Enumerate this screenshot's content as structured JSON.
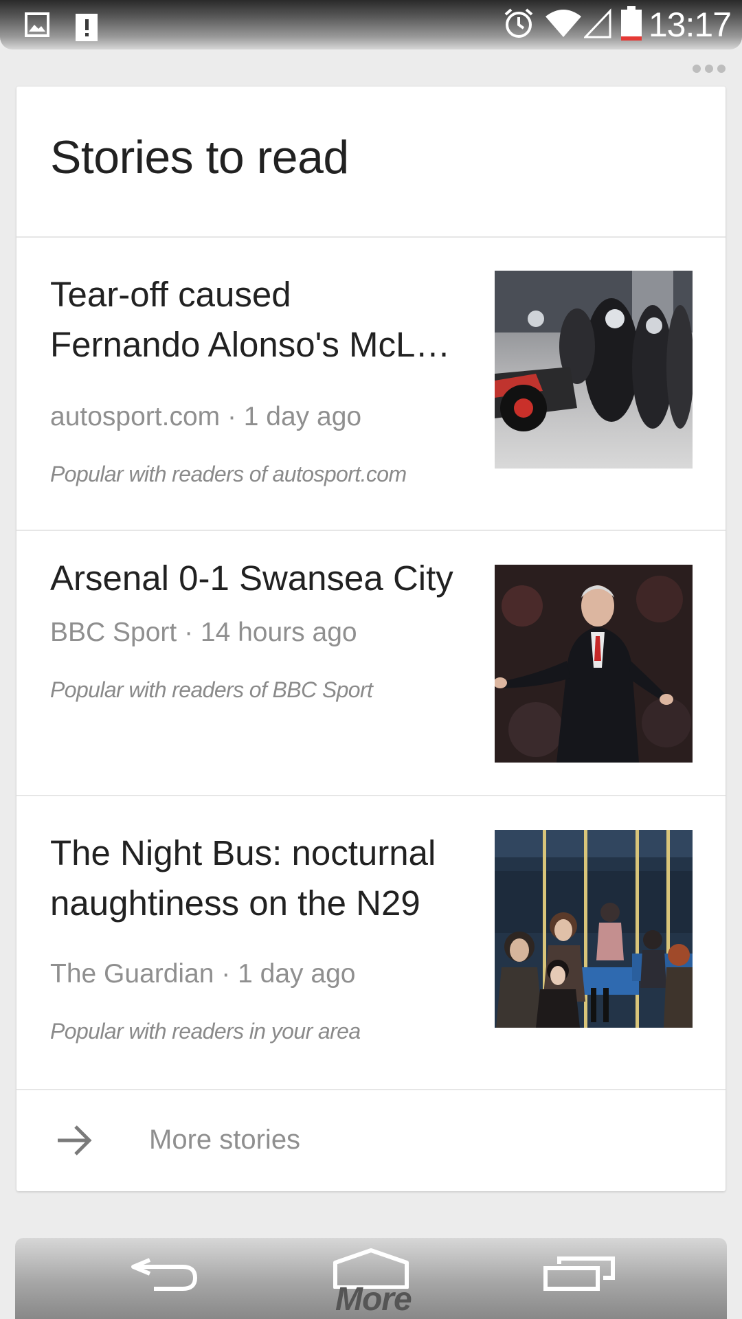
{
  "status_bar": {
    "time": "13:17",
    "icons": [
      "image-notification-icon",
      "sd-card-alert-icon",
      "alarm-icon",
      "wifi-icon",
      "cell-signal-icon",
      "battery-icon"
    ]
  },
  "card": {
    "title": "Stories to read",
    "stories": [
      {
        "title": "Tear-off caused\nFernando Alonso's McL…",
        "meta": "autosport.com · 1 day ago",
        "reason": "Popular with readers of autosport.com",
        "thumbnail": "race-car-pit-stop-photo"
      },
      {
        "title": "Arsenal 0-1 Swansea City",
        "meta": "BBC Sport · 14 hours ago",
        "reason": "Popular with readers of BBC Sport",
        "thumbnail": "football-manager-photo"
      },
      {
        "title": "The Night Bus: nocturnal\nnaughtiness on the N29",
        "meta": "The Guardian · 1 day ago",
        "reason": "Popular with readers in your area",
        "thumbnail": "night-bus-passengers-photo"
      }
    ],
    "more_label": "More stories"
  },
  "nav_bar": {
    "more_label": "More",
    "buttons": [
      "back-icon",
      "home-icon",
      "recents-icon"
    ]
  },
  "colors": {
    "background": "#ececec",
    "card": "#ffffff",
    "title_text": "#212121",
    "secondary_text": "#8f8f8f"
  }
}
